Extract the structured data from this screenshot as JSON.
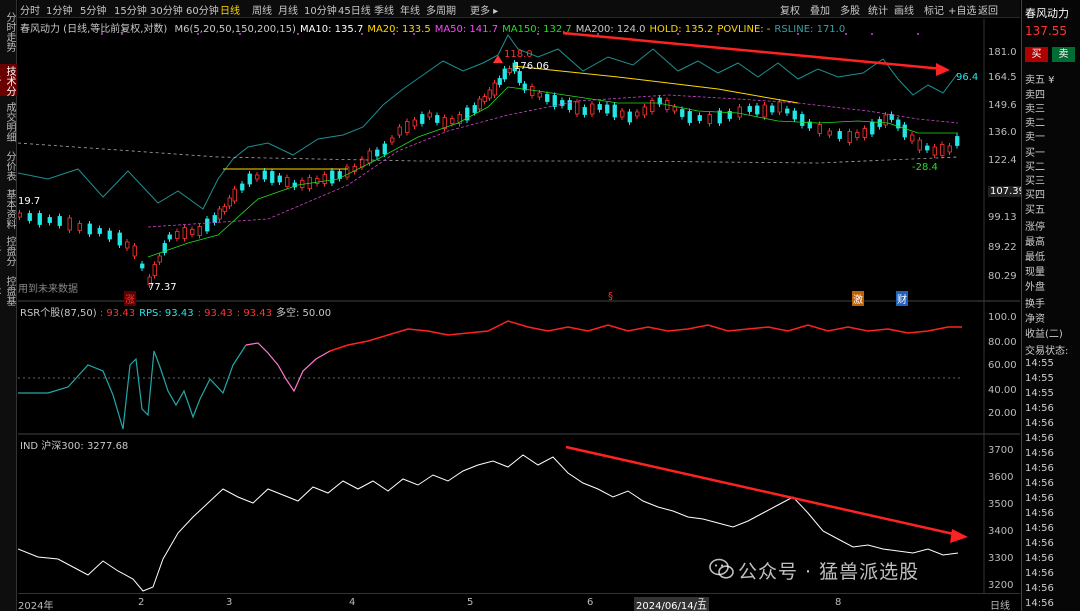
{
  "sidebar": {
    "tabs": [
      {
        "label": "分时走势",
        "active": false
      },
      {
        "label": "技术分析",
        "active": true
      },
      {
        "label": "成交明细",
        "active": false
      },
      {
        "label": "分价表",
        "active": false
      },
      {
        "label": "基本资料",
        "active": false
      },
      {
        "label": "控盘分析",
        "active": false
      },
      {
        "label": "控盘基本",
        "active": false
      }
    ]
  },
  "toolbar": {
    "periods": [
      "分时",
      "1分钟",
      "5分钟",
      "15分钟",
      "30分钟",
      "60分钟",
      "日线",
      "周线",
      "月线",
      "10分钟",
      "45日线",
      "季线",
      "年线",
      "多周期",
      "更多 ▸"
    ],
    "active_period": "日线",
    "tools": [
      "复权",
      "叠加",
      "多股",
      "统计",
      "画线",
      "标记",
      "+自选",
      "返回"
    ]
  },
  "main_chart": {
    "header": "春风动力 (日线,等比前复权,对数)",
    "indicators": [
      {
        "text": "M6(5,20,50,150,200,15)",
        "color": "#c8c8c8"
      },
      {
        "text": "MA10: 135.7",
        "color": "#ffffff"
      },
      {
        "text": "MA20: 133.5",
        "color": "#ffd700"
      },
      {
        "text": "MA50: 141.7",
        "color": "#ff44ff"
      },
      {
        "text": "MA150: 132.7",
        "color": "#22dd22"
      },
      {
        "text": "MA200: 124.0",
        "color": "#c8c8c8"
      },
      {
        "text": "HOLD: 135.2",
        "color": "#ffd700"
      },
      {
        "text": "POVLINE: -",
        "color": "#ffd700"
      },
      {
        "text": "RSLINE: 171.0",
        "color": "#3aa0a0"
      }
    ],
    "y_ticks": [
      "181.0",
      "164.5",
      "149.6",
      "136.0",
      "122.4",
      "107.39",
      "99.13",
      "89.22",
      "80.29"
    ],
    "annotations": {
      "high_marker": "118.0",
      "high_price": "176.06",
      "low_price": "77.37",
      "rs_value": "96.4",
      "rs_low": "-28.4",
      "left_value": "19.7",
      "no_future_data": "用到未来数据",
      "event_zhang": "涨",
      "event_s": "§",
      "event_jie": "激",
      "event_cai": "财"
    },
    "colors": {
      "up": "#ff3333",
      "down": "#22e6e6",
      "trend": "#ff2222"
    }
  },
  "rsr_chart": {
    "header_label": "RSR个股(87,50)",
    "values": [
      {
        "text": ": 93.43",
        "color": "#ff3333"
      },
      {
        "text": "RPS: 93.43",
        "color": "#22e6e6"
      },
      {
        "text": ": 93.43",
        "color": "#ff3333"
      },
      {
        "text": ": 93.43",
        "color": "#ff3333"
      },
      {
        "text": "多空: 50.00",
        "color": "#c8c8c8"
      }
    ],
    "y_ticks": [
      "100.0",
      "80.00",
      "60.00",
      "40.00",
      "20.00"
    ]
  },
  "ind_chart": {
    "header": "IND 沪深300: 3277.68",
    "y_ticks": [
      "3700",
      "3600",
      "3500",
      "3400",
      "3300",
      "3200"
    ]
  },
  "x_axis": {
    "labels": [
      "2024年",
      "2",
      "3",
      "4",
      "5",
      "6",
      "2024/06/14/五",
      "7",
      "8"
    ],
    "period_label": "日线"
  },
  "right_panel": {
    "title": "春风动力",
    "price": "137.55",
    "buy": "买",
    "sell": "卖",
    "rows": [
      "卖五 ¥",
      "卖四",
      "卖三",
      "卖二",
      "卖一",
      "买一",
      "买二",
      "买三",
      "买四",
      "买五",
      "涨停",
      "最高",
      "最低",
      "现量",
      "外盘",
      "换手",
      "净资",
      "收益(二)",
      "交易状态:",
      "14:55",
      "14:55",
      "14:55",
      "14:56",
      "14:56",
      "14:56",
      "14:56",
      "14:56",
      "14:56",
      "14:56",
      "14:56",
      "14:56",
      "14:56",
      "14:56",
      "14:56",
      "14:56",
      "14:56",
      "14:57"
    ]
  },
  "watermark": "公众号 · 猛兽派选股"
}
